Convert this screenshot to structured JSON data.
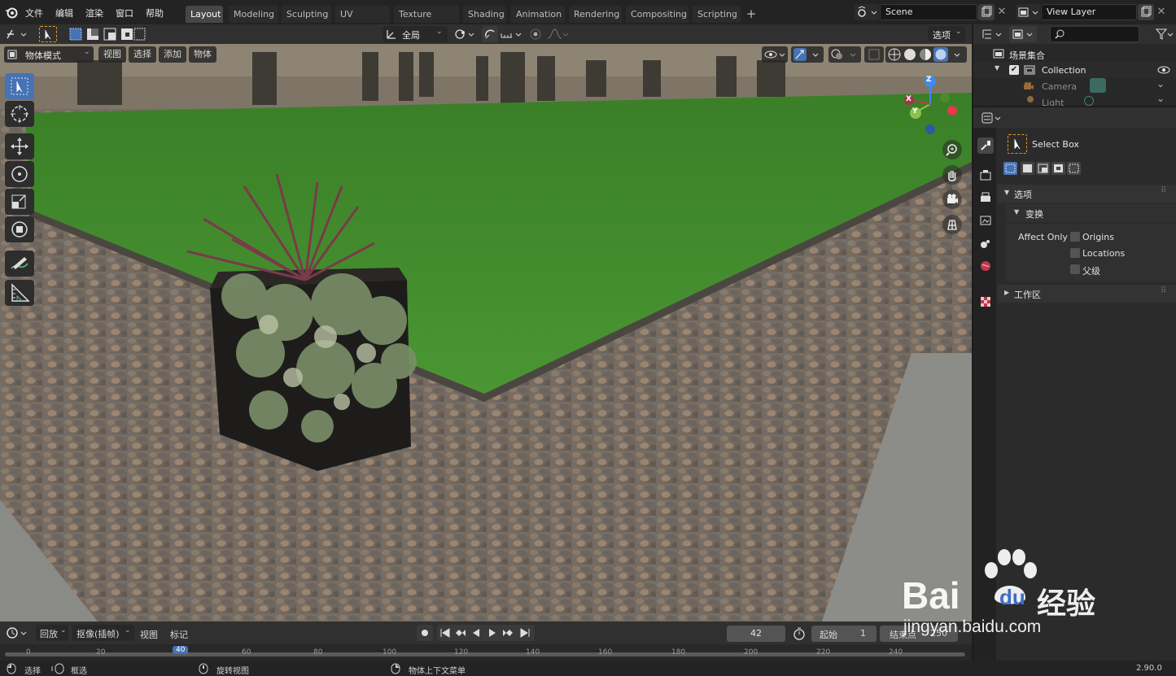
{
  "menu": {
    "file": "文件",
    "edit": "编辑",
    "render": "渲染",
    "window": "窗口",
    "help": "帮助"
  },
  "workspaces": [
    "Layout",
    "Modeling",
    "Sculpting",
    "UV Editing",
    "Texture Paint",
    "Shading",
    "Animation",
    "Rendering",
    "Compositing",
    "Scripting"
  ],
  "scene": {
    "name": "Scene",
    "view_layer": "View Layer"
  },
  "viewport_header": {
    "orientation": "全局",
    "options": "选项",
    "mode": "物体模式",
    "view": "视图",
    "select": "选择",
    "add": "添加",
    "object": "物体"
  },
  "outliner": {
    "root": "场景集合",
    "collection": "Collection",
    "camera": "Camera",
    "light": "Light"
  },
  "properties": {
    "tool_name": "Select Box",
    "options": "选项",
    "transform": "变换",
    "affect_only": "Affect Only",
    "origins": "Origins",
    "locations": "Locations",
    "parents": "父级",
    "workspace": "工作区"
  },
  "timeline": {
    "playback": "回放",
    "keying": "抠像(插帧)",
    "view": "视图",
    "marker": "标记",
    "current_frame": "42",
    "start_label": "起始",
    "start": "1",
    "end_label": "结束点",
    "end": "250",
    "ticks": [
      "0",
      "20",
      "40",
      "60",
      "80",
      "100",
      "120",
      "140",
      "160",
      "180",
      "200",
      "220",
      "240"
    ]
  },
  "status": {
    "select": "选择",
    "box_select": "框选",
    "rotate_view": "旋转视图",
    "context_menu": "物体上下文菜单",
    "version": "2.90.0"
  },
  "watermark": {
    "brand": "Bai",
    "du": "du",
    "cn": "经验",
    "url": "jingyan.baidu.com"
  },
  "gizmo": {
    "x": "X",
    "y": "Y",
    "z": "Z"
  },
  "colors": {
    "accent": "#4772b3",
    "active_tab": "#474747",
    "grass": "#3d8a2a",
    "cobble": "#6f6860"
  }
}
